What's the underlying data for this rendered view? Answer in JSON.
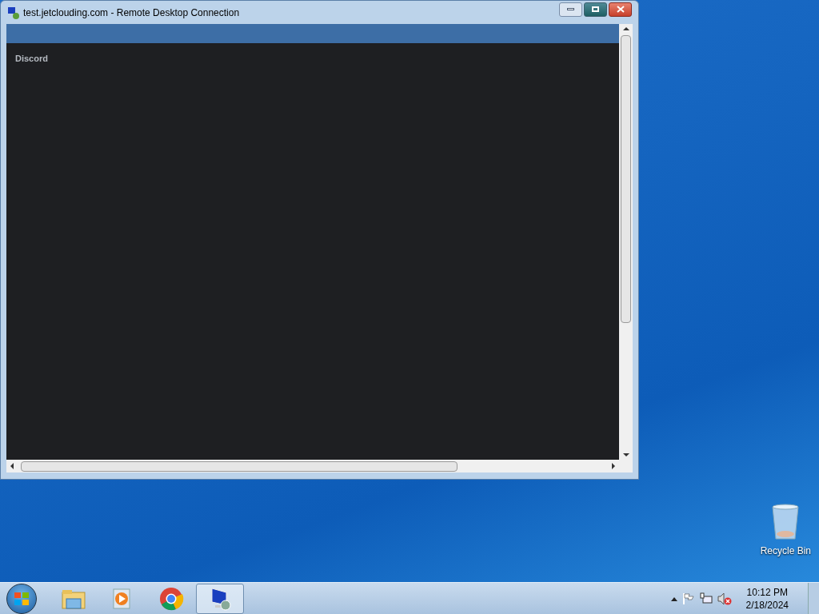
{
  "window": {
    "title": "test.jetclouding.com - Remote Desktop Connection"
  },
  "remote_screen": {
    "app_title": "Discord"
  },
  "desktop_icons": [
    {
      "label": "Recycle Bin"
    }
  ],
  "taskbar": {
    "items": [
      {
        "kind": "explorer",
        "selected": false
      },
      {
        "kind": "media",
        "selected": false
      },
      {
        "kind": "browser",
        "selected": false
      },
      {
        "kind": "remote",
        "selected": true
      }
    ],
    "clock": {
      "time": "10:12 PM",
      "date": "2/18/2024"
    }
  }
}
